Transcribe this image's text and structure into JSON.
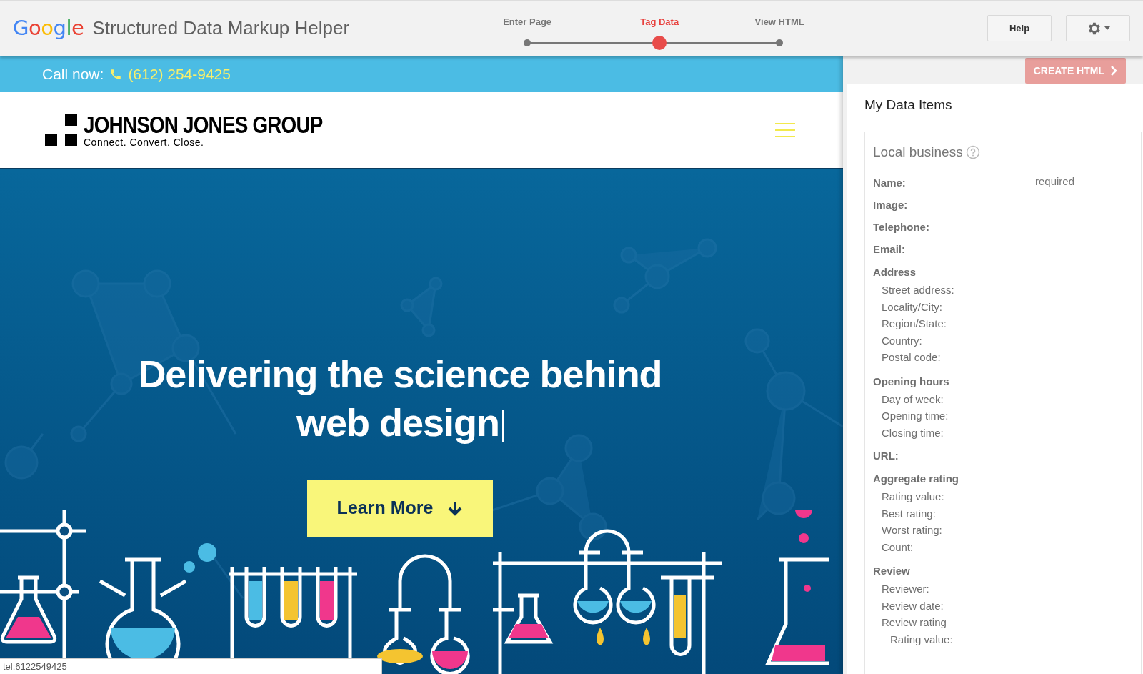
{
  "header": {
    "logo": "Google",
    "app_title": "Structured Data Markup Helper",
    "steps": [
      {
        "label": "Enter Page",
        "selected": false
      },
      {
        "label": "Tag Data",
        "selected": true
      },
      {
        "label": "View HTML",
        "selected": false
      }
    ],
    "help_button": "Help"
  },
  "site": {
    "call_label": "Call now:",
    "phone": "(612) 254-9425",
    "brand": "JOHNSON JONES GROUP",
    "tagline": "Connect. Convert. Close.",
    "headline_lines": [
      "Delivering the science behind",
      "web design"
    ],
    "cta": "Learn More"
  },
  "status_bar": "tel:6122549425",
  "panel": {
    "create_button": "CREATE HTML",
    "title": "My Data Items",
    "section": "Local business",
    "items": [
      {
        "kind": "field",
        "label": "Name:",
        "note": "required"
      },
      {
        "kind": "field",
        "label": "Image:"
      },
      {
        "kind": "field",
        "label": "Telephone:"
      },
      {
        "kind": "field",
        "label": "Email:"
      },
      {
        "kind": "group",
        "label": "Address",
        "children": [
          {
            "label": "Street address:"
          },
          {
            "label": "Locality/City:"
          },
          {
            "label": "Region/State:"
          },
          {
            "label": "Country:"
          },
          {
            "label": "Postal code:"
          }
        ]
      },
      {
        "kind": "group",
        "label": "Opening hours",
        "children": [
          {
            "label": "Day of week:"
          },
          {
            "label": "Opening time:"
          },
          {
            "label": "Closing time:"
          }
        ]
      },
      {
        "kind": "field",
        "label": "URL:"
      },
      {
        "kind": "group",
        "label": "Aggregate rating",
        "children": [
          {
            "label": "Rating value:"
          },
          {
            "label": "Best rating:"
          },
          {
            "label": "Worst rating:"
          },
          {
            "label": "Count:"
          }
        ]
      },
      {
        "kind": "group",
        "label": "Review",
        "children": [
          {
            "label": "Reviewer:"
          },
          {
            "label": "Review date:"
          },
          {
            "label": "Review rating",
            "children": [
              {
                "label": "Rating value:"
              }
            ]
          }
        ]
      }
    ]
  }
}
